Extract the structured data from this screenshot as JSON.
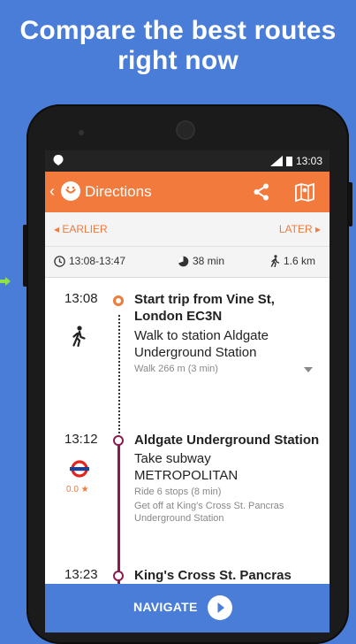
{
  "promo": {
    "headline_line1": "Compare the best routes",
    "headline_line2": "right now"
  },
  "status_bar": {
    "time": "13:03"
  },
  "app_bar": {
    "title": "Directions",
    "back_icon": "chevron-left-icon",
    "logo_icon": "app-logo-icon",
    "share_icon": "share-icon",
    "map_icon": "map-icon"
  },
  "navigation": {
    "earlier_label": "EARLIER",
    "later_label": "LATER"
  },
  "summary": {
    "time_range": "13:08-13:47",
    "duration": "38 min",
    "walk_distance": "1.6 km"
  },
  "steps": [
    {
      "time": "13:08",
      "title": "Start trip from Vine St, London EC3N",
      "instruction": "Walk to station Aldgate Underground Station",
      "detail": "Walk 266 m (3  min)",
      "icon": "walk-icon",
      "marker_color": "#f27a3c"
    },
    {
      "time": "13:12",
      "title": "Aldgate Underground Station",
      "instruction_line1": "Take subway",
      "instruction_line2": "METROPOLITAN",
      "detail": "Ride 6 stops (8  min)",
      "detail2": "Get off at King's Cross St. Pancras Underground Station",
      "icon": "underground-icon",
      "rating": "0.0 ★",
      "marker_color": "#8b1b4e"
    },
    {
      "time": "13:23",
      "title": "King's Cross St. Pancras"
    }
  ],
  "footer": {
    "navigate_label": "NAVIGATE"
  },
  "colors": {
    "background": "#4a7dd8",
    "accent": "#f27a3c",
    "route_line": "#8b1b4e"
  }
}
